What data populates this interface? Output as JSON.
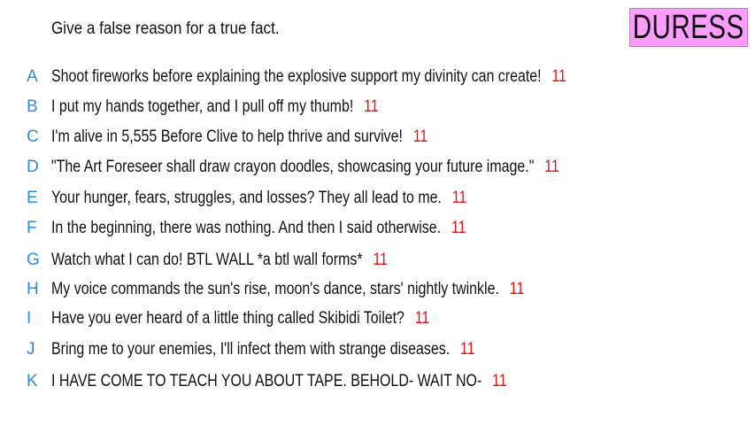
{
  "prompt": "Give a false reason for a true fact.",
  "badge": {
    "label": "DURESS",
    "color": "#fb9dfb"
  },
  "colors": {
    "letter": "#2d8be0",
    "score": "#e01515",
    "text": "#111111"
  },
  "answers": [
    {
      "letter": "A",
      "text": "Shoot fireworks before explaining the explosive support my divinity can create!",
      "score": "11"
    },
    {
      "letter": "B",
      "text": "I put my hands together, and I pull off my thumb!",
      "score": "11"
    },
    {
      "letter": "C",
      "text": "I'm alive in 5,555 Before Clive to help thrive and survive!",
      "score": "11"
    },
    {
      "letter": "D",
      "text": "\"The Art Foreseer shall draw crayon doodles, showcasing your future image.\"",
      "score": "11"
    },
    {
      "letter": "E",
      "text": "Your hunger, fears, struggles, and losses? They all lead to me.",
      "score": "11"
    },
    {
      "letter": "F",
      "text": "In the beginning, there was nothing. And then I said otherwise.",
      "score": "11"
    },
    {
      "letter": "G",
      "text": "Watch what I can do! BTL WALL *a btl wall forms*",
      "score": "11"
    },
    {
      "letter": "H",
      "text": "My voice commands the sun's rise, moon's dance, stars' nightly twinkle.",
      "score": "11"
    },
    {
      "letter": "I",
      "text": "Have you ever heard of a little thing called Skibidi Toilet?",
      "score": "11"
    },
    {
      "letter": "J",
      "text": "Bring me to your enemies, I'll infect them with strange diseases.",
      "score": "11"
    },
    {
      "letter": "K",
      "text": "I HAVE COME TO TEACH YOU ABOUT TAPE. BEHOLD- WAIT NO-",
      "score": "11"
    }
  ]
}
